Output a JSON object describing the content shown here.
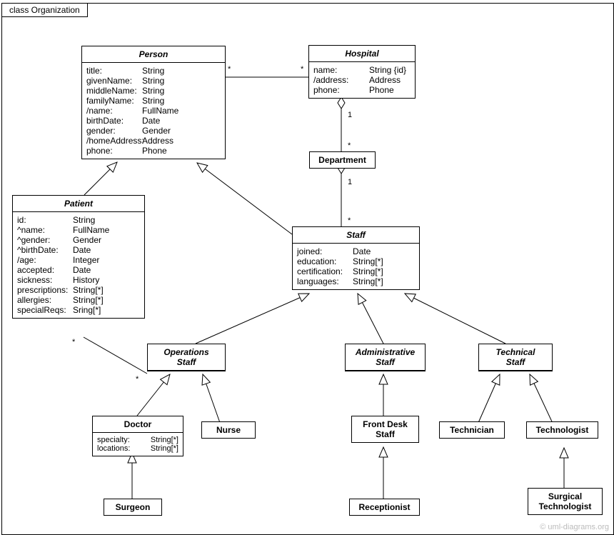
{
  "frameTitle": "class Organization",
  "watermark": "© uml-diagrams.org",
  "classes": {
    "person": {
      "name": "Person",
      "attrs": [
        {
          "k": "title:",
          "v": "String"
        },
        {
          "k": "givenName:",
          "v": "String"
        },
        {
          "k": "middleName:",
          "v": "String"
        },
        {
          "k": "familyName:",
          "v": "String"
        },
        {
          "k": "/name:",
          "v": "FullName"
        },
        {
          "k": "birthDate:",
          "v": "Date"
        },
        {
          "k": "gender:",
          "v": "Gender"
        },
        {
          "k": "/homeAddress:",
          "v": "Address"
        },
        {
          "k": "phone:",
          "v": "Phone"
        }
      ]
    },
    "hospital": {
      "name": "Hospital",
      "attrs": [
        {
          "k": "name:",
          "v": "String {id}"
        },
        {
          "k": "/address:",
          "v": "Address"
        },
        {
          "k": "phone:",
          "v": "Phone"
        }
      ]
    },
    "department": {
      "name": "Department"
    },
    "patient": {
      "name": "Patient",
      "attrs": [
        {
          "k": "id:",
          "v": "String"
        },
        {
          "k": "^name:",
          "v": "FullName"
        },
        {
          "k": "^gender:",
          "v": "Gender"
        },
        {
          "k": "^birthDate:",
          "v": "Date"
        },
        {
          "k": "/age:",
          "v": "Integer"
        },
        {
          "k": "accepted:",
          "v": "Date"
        },
        {
          "k": "sickness:",
          "v": "History"
        },
        {
          "k": "prescriptions:",
          "v": "String[*]"
        },
        {
          "k": "allergies:",
          "v": "String[*]"
        },
        {
          "k": "specialReqs:",
          "v": "Sring[*]"
        }
      ]
    },
    "staff": {
      "name": "Staff",
      "attrs": [
        {
          "k": "joined:",
          "v": "Date"
        },
        {
          "k": "education:",
          "v": "String[*]"
        },
        {
          "k": "certification:",
          "v": "String[*]"
        },
        {
          "k": "languages:",
          "v": "String[*]"
        }
      ]
    },
    "opsStaff": {
      "name": "OperationsStaff",
      "display": "Operations\nStaff"
    },
    "adminStaff": {
      "name": "AdministrativeStaff",
      "display": "Administrative\nStaff"
    },
    "techStaff": {
      "name": "TechnicalStaff",
      "display": "Technical\nStaff"
    },
    "doctor": {
      "name": "Doctor",
      "attrs": [
        {
          "k": "specialty:",
          "v": "String[*]"
        },
        {
          "k": "locations:",
          "v": "String[*]"
        }
      ]
    },
    "nurse": {
      "name": "Nurse"
    },
    "frontDesk": {
      "name": "FrontDeskStaff",
      "display": "Front Desk\nStaff"
    },
    "technician": {
      "name": "Technician"
    },
    "technologist": {
      "name": "Technologist"
    },
    "surgeon": {
      "name": "Surgeon"
    },
    "receptionist": {
      "name": "Receptionist"
    },
    "surgicalTech": {
      "name": "SurgicalTechnologist",
      "display": "Surgical\nTechnologist"
    }
  },
  "multiplicities": {
    "personHospital_left": "*",
    "personHospital_right": "*",
    "hospitalDept_top": "1",
    "hospitalDept_bottom": "*",
    "deptStaff_top": "1",
    "deptStaff_bottom": "*",
    "patientOps_left": "*",
    "patientOps_right": "*"
  }
}
